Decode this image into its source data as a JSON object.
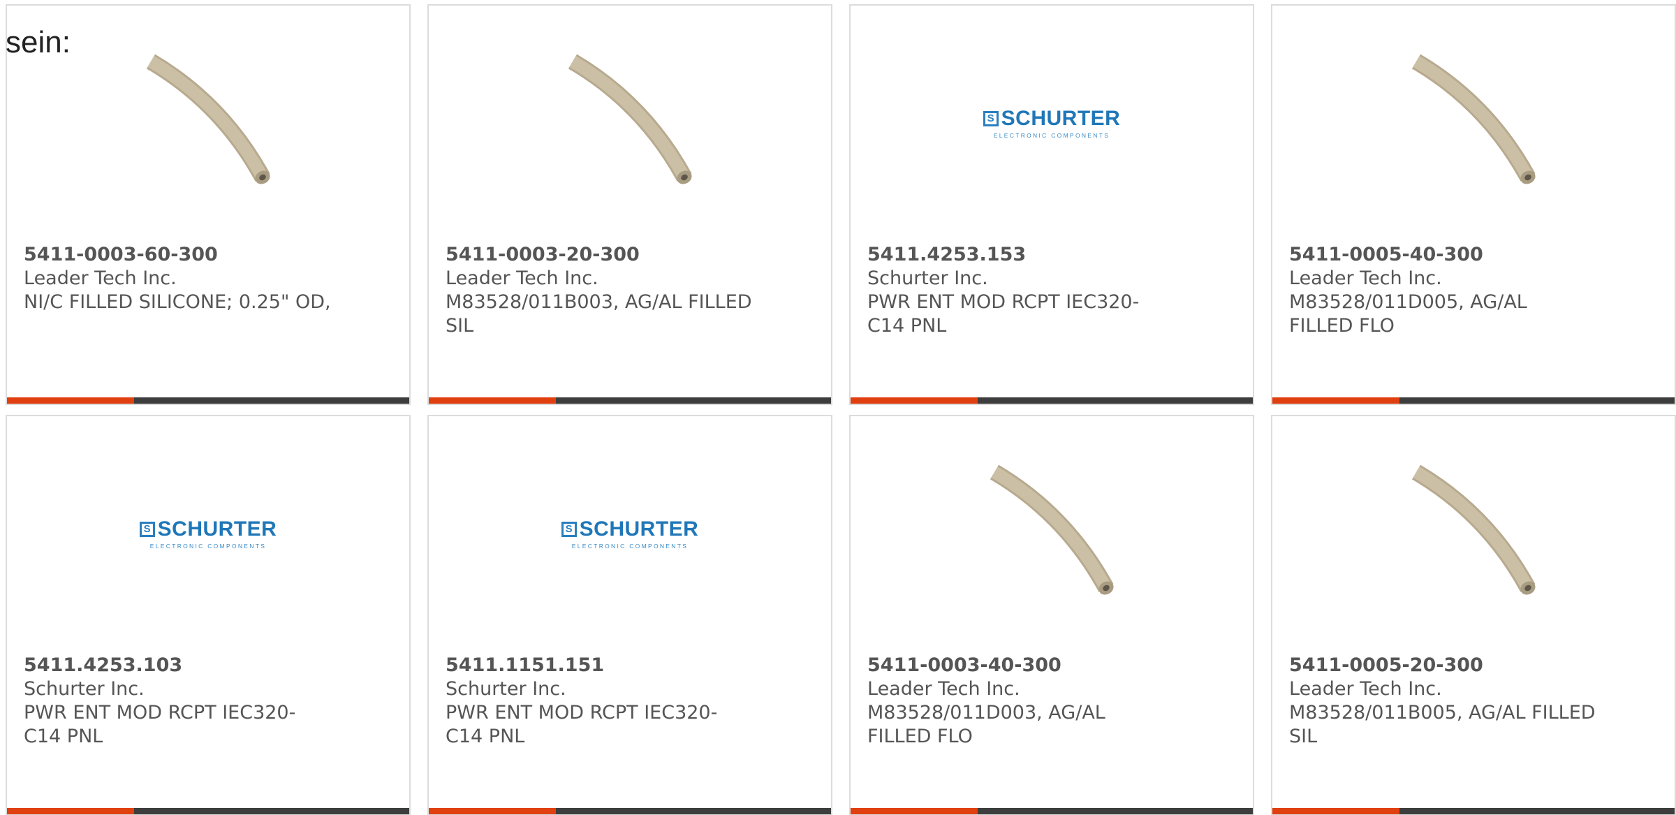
{
  "intro_text": "sein:",
  "colors": {
    "accent": "#e04010",
    "bar": "#3d3d3d",
    "text": "#555555",
    "border": "#dcdcdc",
    "tube": "#cbbfa5",
    "logo_blue": "#1f77b8"
  },
  "logo": {
    "mark": "S",
    "word": "SCHURTER",
    "sub": "ELECTRONIC COMPONENTS"
  },
  "products": [
    {
      "part": "5411-0003-60-300",
      "maker": "Leader Tech Inc.",
      "desc": "NI/C FILLED SILICONE; 0.25\" OD,",
      "image": "tube-image"
    },
    {
      "part": "5411-0003-20-300",
      "maker": "Leader Tech Inc.",
      "desc": "M83528/011B003, AG/AL FILLED SIL",
      "image": "tube-image"
    },
    {
      "part": "5411.4253.153",
      "maker": "Schurter Inc.",
      "desc": "PWR ENT MOD RCPT IEC320-C14 PNL",
      "image": "schurter-logo"
    },
    {
      "part": "5411-0005-40-300",
      "maker": "Leader Tech Inc.",
      "desc": "M83528/011D005, AG/AL FILLED FLO",
      "image": "tube-image"
    },
    {
      "part": "5411.4253.103",
      "maker": "Schurter Inc.",
      "desc": "PWR ENT MOD RCPT IEC320-C14 PNL",
      "image": "schurter-logo"
    },
    {
      "part": "5411.1151.151",
      "maker": "Schurter Inc.",
      "desc": "PWR ENT MOD RCPT IEC320-C14 PNL",
      "image": "schurter-logo"
    },
    {
      "part": "5411-0003-40-300",
      "maker": "Leader Tech Inc.",
      "desc": "M83528/011D003, AG/AL FILLED FLO",
      "image": "tube-image"
    },
    {
      "part": "5411-0005-20-300",
      "maker": "Leader Tech Inc.",
      "desc": "M83528/011B005, AG/AL FILLED SIL",
      "image": "tube-image"
    }
  ]
}
